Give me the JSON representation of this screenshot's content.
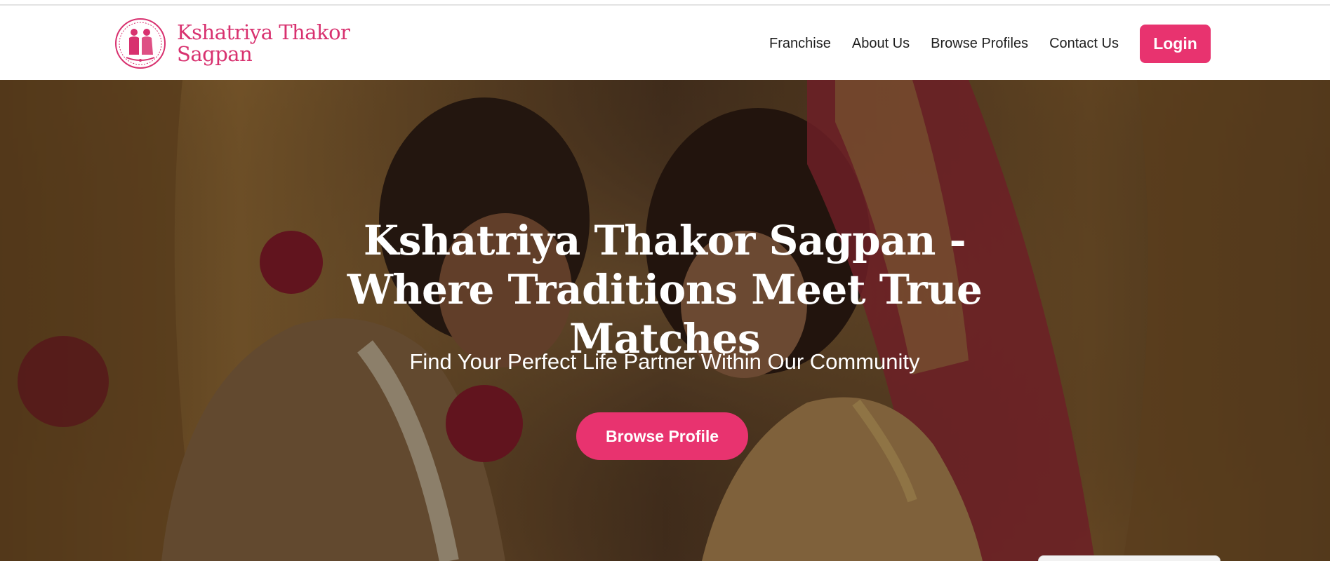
{
  "brand": {
    "name": "Kshatriya Thakor Sagpan",
    "logo_icon": "couple-emblem-icon",
    "color": "#d8316f"
  },
  "nav": {
    "items": [
      {
        "label": "Franchise"
      },
      {
        "label": "About Us"
      },
      {
        "label": "Browse Profiles"
      },
      {
        "label": "Contact Us"
      }
    ],
    "login_label": "Login"
  },
  "hero": {
    "title": "Kshatriya Thakor Sagpan - Where Traditions Meet True Matches",
    "subtitle": "Find Your Perfect Life Partner Within Our Community",
    "cta_label": "Browse Profile",
    "background": "wedding-couple-photo"
  },
  "colors": {
    "accent": "#e8336f",
    "nav_text": "#1e1e1e"
  }
}
